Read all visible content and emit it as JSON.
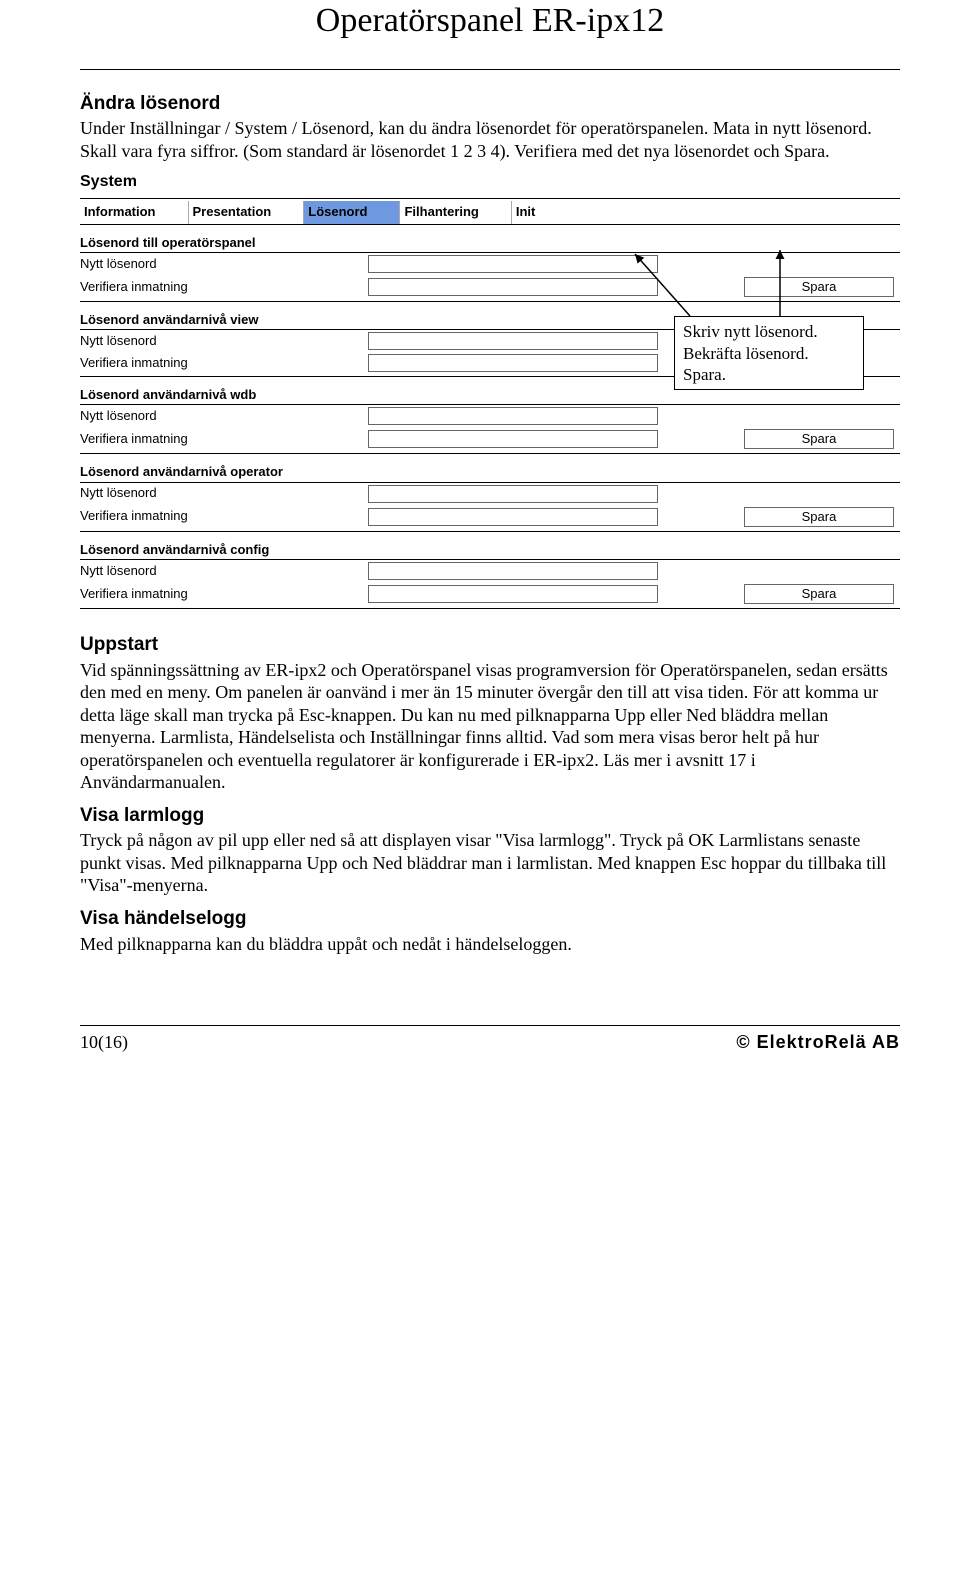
{
  "title": "Operatörspanel ER-ipx12",
  "sections": {
    "andra": {
      "heading": "Ändra lösenord",
      "body": "Under Inställningar / System / Lösenord, kan du ändra lösenordet för operatörspanelen. Mata in nytt lösenord. Skall vara fyra siffror. (Som standard är lösenordet 1 2 3 4). Verifiera med det nya lösenordet och Spara."
    },
    "uppstart": {
      "heading": "Uppstart",
      "body": "Vid spänningssättning av ER-ipx2 och Operatörspanel visas programversion för Operatörspanelen, sedan ersätts den med en meny. Om panelen är oanvänd i mer än 15 minuter övergår den till att visa tiden. För att komma ur detta läge skall man trycka på Esc-knappen. Du kan nu med pilknapparna Upp eller Ned bläddra mellan menyerna. Larmlista, Händelselista och Inställningar finns alltid. Vad som mera visas beror helt på hur operatörspanelen och eventuella regulatorer är konfigurerade i ER-ipx2. Läs mer i avsnitt 17 i Användarmanualen."
    },
    "larmlogg": {
      "heading": "Visa larmlogg",
      "body": "Tryck på någon av pil upp eller ned så att displayen visar \"Visa larmlogg\". Tryck på OK Larmlistans senaste punkt visas. Med pilknapparna Upp och Ned bläddrar man i larmlistan. Med knappen Esc hoppar du tillbaka till \"Visa\"-menyerna."
    },
    "handelselogg": {
      "heading": "Visa händelselogg",
      "body": "Med pilknapparna kan du bläddra uppåt och nedåt i händelseloggen."
    }
  },
  "ui": {
    "system_label": "System",
    "tabs": [
      "Information",
      "Presentation",
      "Lösenord",
      "Filhantering",
      "Init"
    ],
    "selected_tab_index": 2,
    "labels": {
      "nytt": "Nytt lösenord",
      "verifiera": "Verifiera inmatning",
      "spara": "Spara"
    },
    "groups": [
      "Lösenord till operatörspanel",
      "Lösenord användarnivå view",
      "Lösenord användarnivå wdb",
      "Lösenord användarnivå operator",
      "Lösenord användarnivå config"
    ]
  },
  "callout": {
    "line1": "Skriv nytt lösenord.",
    "line2": "Bekräfta lösenord.",
    "line3": "Spara."
  },
  "footer": {
    "page": "10(16)",
    "org": "© ElektroRelä AB"
  }
}
